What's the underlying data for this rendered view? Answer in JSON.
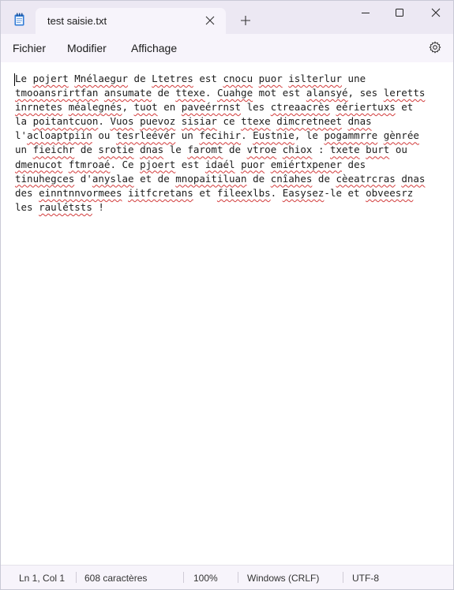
{
  "tab": {
    "title": "test saisie.txt"
  },
  "menu": {
    "file": "Fichier",
    "edit": "Modifier",
    "view": "Affichage"
  },
  "editor": {
    "lines": [
      "Le pojert Mnélaegur de Ltetres est cnocu puor islterlur une",
      "tmooansrirtfan ansumate de ttexe. Cuahge mot est alansyé, ses leretts",
      "inrnetes méalegnés, tuot en paveérrnst les ctreaacrès eériertuxs et",
      "la poitantcuon. Vuos puevoz sisiar ce ttexe dimcretneet dnas",
      "l'acloaptpiin ou tesrleévér un fecihir. Eustnie, le pogammrre gènrée",
      "un fieichr de srotie dnas le faromt de vtroe chiox : txete burt ou",
      "dmenucot ftmroaé. Ce pjoert est idaél puor emiértxpener des",
      "tinuhegces d'anyslae et de mnopaitiluan de cnîahes de cèeatrcras dnas",
      "des einntnnvormees iitfcretans et fileexlbs. Easysez-le et obveesrz",
      "les raulétsts !"
    ],
    "misspelled": [
      "pojert",
      "Mnélaegur",
      "Ltetres",
      "cnocu",
      "puor",
      "islterlur",
      "tmooansrirtfan",
      "ansumate",
      "ttexe",
      "Cuahge",
      "alansyé",
      "leretts",
      "inrnetes",
      "méalegnés",
      "tuot",
      "paveérrnst",
      "ctreaacrès",
      "eériertuxs",
      "poitantcuon",
      "Vuos",
      "puevoz",
      "sisiar",
      "dimcretneet",
      "dnas",
      "acloaptpiin",
      "tesrleévér",
      "fecihir",
      "Eustnie",
      "pogammrre",
      "gènrée",
      "fieichr",
      "srotie",
      "faromt",
      "vtroe",
      "chiox",
      "txete",
      "burt",
      "dmenucot",
      "ftmroaé",
      "pjoert",
      "idaél",
      "emiértxpener",
      "tinuhegces",
      "anyslae",
      "mnopaitiluan",
      "cnîahes",
      "cèeatrcras",
      "einntnnvormees",
      "iitfcretans",
      "fileexlbs",
      "Easysez",
      "obveesrz",
      "raulétsts"
    ]
  },
  "status": {
    "position": "Ln 1, Col 1",
    "count": "608 caractères",
    "zoom": "100%",
    "line_endings": "Windows (CRLF)",
    "encoding": "UTF-8"
  },
  "icons": {
    "app": "notepad-icon",
    "tab_close": "close-icon",
    "new_tab": "plus-icon",
    "minimize": "minimize-icon",
    "maximize": "maximize-icon",
    "close": "close-icon",
    "settings": "gear-icon"
  },
  "colors": {
    "spellcheck": "#d23b3b",
    "titlebar": "#ece8f3",
    "accent": "#1f6fd1"
  }
}
